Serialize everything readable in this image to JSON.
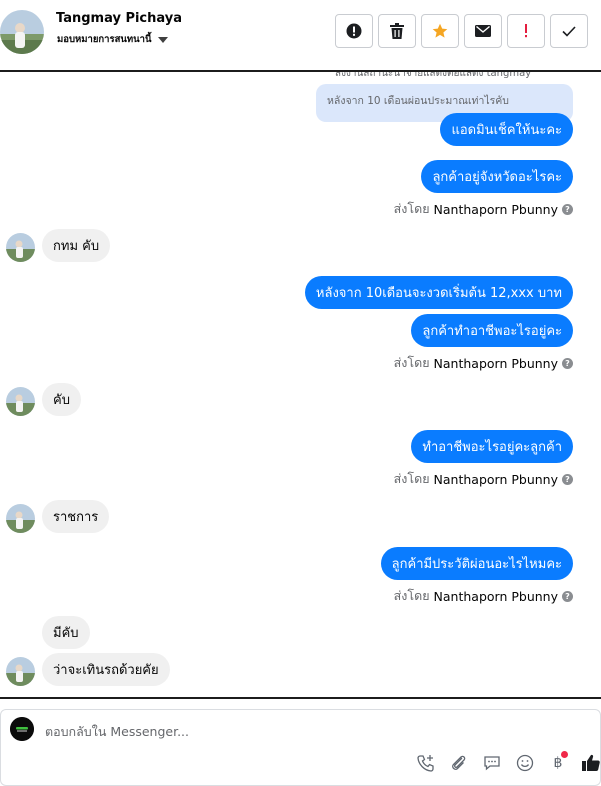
{
  "header": {
    "contact_name": "Tangmay Pichaya",
    "assignee_label": "มอบหมายการสนทนานี้",
    "toolbar": [
      "mark-spam-icon",
      "trash-icon",
      "star-icon",
      "mail-icon",
      "important-icon",
      "check-icon"
    ]
  },
  "thread": {
    "clipped_top_text": "ส่งงานสถานะนำจ่ายแสดงต่อแสดง tangmay",
    "reply_preview": "หลังจาก 10 เดือนผ่อนประมาณเท่าไรคับ",
    "messages": [
      {
        "dir": "out",
        "text": "แอดมินเช็คให้นะคะ"
      },
      {
        "dir": "out",
        "text": "ลูกค้าอยู่จังหวัดอะไรคะ"
      },
      {
        "dir": "in",
        "text": "กทม คับ"
      },
      {
        "dir": "out",
        "text": "หลังจาก 10เดือนจะงวดเริ่มต้น 12,xxx บาท"
      },
      {
        "dir": "out",
        "text": "ลูกค้าทำอาชีพอะไรอยู่คะ"
      },
      {
        "dir": "in",
        "text": "คับ"
      },
      {
        "dir": "out",
        "text": "ทำอาชีพอะไรอยู่คะลูกค้า"
      },
      {
        "dir": "in",
        "text": "ราชการ"
      },
      {
        "dir": "out",
        "text": "ลูกค้ามีประวัติผ่อนอะไรไหมคะ"
      },
      {
        "dir": "in",
        "text": "มีคับ"
      },
      {
        "dir": "in",
        "text": "ว่าจะเทินรถด้วยคัย"
      }
    ],
    "sent_by_prefix": "ส่งโดย",
    "sent_by_agent": "Nanthaporn Pbunny"
  },
  "composer": {
    "placeholder": "ตอบกลับใน Messenger...",
    "value": "",
    "actions": [
      "add-call-icon",
      "attachment-icon",
      "saved-reply-icon",
      "emoji-icon",
      "payment-baht-icon",
      "like-icon"
    ],
    "payment_symbol": "฿"
  },
  "colors": {
    "outgoing_bubble": "#0a7cff",
    "incoming_bubble": "#f0f0f0",
    "star": "#f5a623",
    "important": "#e41e3f",
    "notification_dot": "#f02849"
  }
}
